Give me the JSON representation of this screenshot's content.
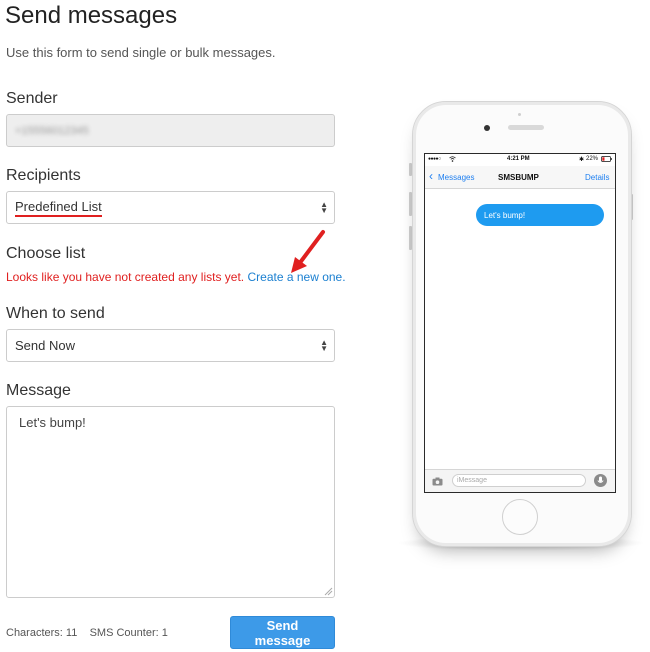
{
  "page": {
    "title": "Send messages",
    "subtitle": "Use this form to send single or bulk messages."
  },
  "form": {
    "sender": {
      "label": "Sender",
      "value": "+15556012345"
    },
    "recipients": {
      "label": "Recipients",
      "selected": "Predefined List"
    },
    "choose_list": {
      "label": "Choose list",
      "error_text": "Looks like you have not created any lists yet.",
      "create_link": "Create a new one."
    },
    "when_to_send": {
      "label": "When to send",
      "selected": "Send Now"
    },
    "message": {
      "label": "Message",
      "value": "Let's bump!"
    },
    "counters": {
      "characters_label": "Characters:",
      "characters_value": "11",
      "sms_label": "SMS Counter:",
      "sms_value": "1"
    },
    "send_button": "Send message"
  },
  "phone_preview": {
    "status": {
      "carrier": "●●●●○",
      "time": "4:21 PM",
      "battery": "22%"
    },
    "nav": {
      "back_label": "Messages",
      "title": "SMSBUMP",
      "details_label": "Details"
    },
    "bubble_text": "Let's bump!",
    "input_placeholder": "iMessage"
  },
  "colors": {
    "error_red": "#e02020",
    "link_blue": "#1a7fd0",
    "button_blue": "#3d9ae8",
    "imessage_blue": "#1e9bf0"
  },
  "icons": [
    "chevron-updown-icon",
    "red-arrow-annotation",
    "camera-icon",
    "microphone-icon",
    "back-chevron-icon",
    "wifi-icon",
    "battery-icon"
  ]
}
